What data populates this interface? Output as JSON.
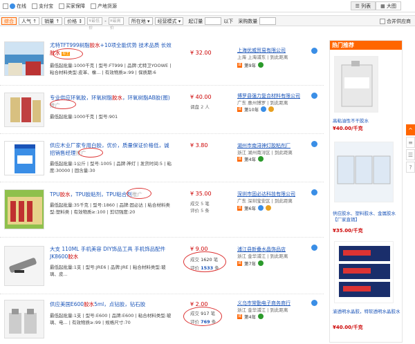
{
  "filters": {
    "online": "在线",
    "alipay": "支付宝",
    "buyer_protection": "买家保障",
    "source": "产地货源",
    "view_list": "列表",
    "view_grid": "大图"
  },
  "sortbar": {
    "comprehensive": "综合",
    "popularity": "人气",
    "sales": "销量",
    "price": "价格",
    "price_min_placeholder": "¥最低价",
    "price_max_placeholder": "¥最高价",
    "location": "所在地",
    "business_mode": "经营模式",
    "min_order": "起订量",
    "below": "以下",
    "purchase_qty": "采购数量",
    "merge_supplier": "合并供应商"
  },
  "products": [
    {
      "title_a": "尤特TFT999树脂",
      "title_hl": "胶水",
      "title_b": "+10项全能优势 技术品质 长效",
      "title_c": "胶水",
      "tag": "标王",
      "meta1": "最低起批量:1000千克 | 型号:FT999 | 品牌:尤特卫YOOWE |",
      "meta2": "粘合材料类型:皮革、橡... | 有效物质≥:99 | 保质期:6",
      "price": "¥ 32.00",
      "company": "上海优威贸易有限公司",
      "location": "上海 上海浦东 | 到此距离",
      "years": "第9年"
    },
    {
      "title_a": "专业供应环氧胶，环氧树脂",
      "title_hl": "胶水",
      "title_b": "，环氧树脂AB胶(图)",
      "title_c": "",
      "tag": "推广",
      "meta1": "最低起批量:1000千克 | 型号:901",
      "meta2": "",
      "price": "¥ 40.00",
      "sub": "调盘 2 人",
      "company": "博罗县强力复合材料有限公司",
      "location": "广东 惠州博罗 | 到此距离",
      "years": "第10年"
    },
    {
      "title_a": "供应木业厂家专用白胶，优价，质量保证价格低，诚",
      "title_hl": "",
      "title_b": "招销售经理",
      "title_c": "",
      "tag": "推广",
      "meta1": "最低起批量:1公斤 | 型号:1005 | 品牌:神灯 | 发货时间:5 | 粘",
      "meta2": "度:30000 | 固含量:30",
      "price": "¥ 3.80",
      "company": "湖州市南浔神灯胶粘剂厂",
      "location": "浙江 湖州南浔区 | 到此距离",
      "years": "第4年"
    },
    {
      "title_a": "TPU",
      "title_hl": "胶水",
      "title_b": "，TPU胶粘剂，TPU粘合剂",
      "title_c": "",
      "tag": "推广",
      "meta1": "最低起批量:35千克 | 型号:1860 | 品牌:固必达 | 粘合材料类",
      "meta2": "型:塑料类 | 有效物质≥:100 | 剪切强度:20",
      "price": "¥ 35.00",
      "sub1": "成交 5 笔",
      "sub2": "评价 5 条",
      "company": "深圳市固必达科技有限公司",
      "location": "广东 深圳宝安区 | 到此距离",
      "years": "第6年"
    },
    {
      "title_a": "大支 110ML 手机美容 DIY饰品工具 手机饰品配件",
      "title_hl": "",
      "title_b": "JK8600",
      "title_c": "胶水",
      "tag": "",
      "meta1": "最低起批量:1支 | 型号:JRE6 | 品牌:JRE | 粘合材料类型:玻",
      "meta2": "璃、皮...",
      "price": "¥ 9.00",
      "sub1": "成交",
      "sub1n": "1620",
      "sub1u": "笔",
      "sub2": "评价",
      "sub2n": "1533",
      "sub2u": "条",
      "company": "浦江县新叠水晶饰品店",
      "location": "浙江 金华浦江 | 到此距离",
      "years": "第7年"
    },
    {
      "title_a": "供应美国E600",
      "title_hl": "胶水",
      "title_b": "5ml，点钻胶，钻石胶",
      "title_c": "",
      "tag": "",
      "meta1": "最低起批量:1支 | 型号:E600 | 品牌:E600 | 粘合材料类型:玻",
      "meta2": "璃、电... | 有效物质≥:99 | 规格尺寸:70",
      "price": "¥ 2.00",
      "sub1": "成交",
      "sub1n": "917",
      "sub1u": "笔",
      "sub2": "评价",
      "sub2n": "769",
      "sub2u": "条",
      "company": "义乌市常勤电子商务商行",
      "location": "浙江 金华浦江 | 到此距离",
      "years": "第4年"
    }
  ],
  "hot": {
    "header": "热门推荐",
    "items": [
      {
        "title": "高粘油性不干胶水",
        "price": "¥40.00/千克"
      },
      {
        "title": "供应胶水、塑料胶水、金属胶水【厂家直销】",
        "price": "¥35.00/千克"
      },
      {
        "title": "渝透明水晶胶，特软透明水晶胶水",
        "price": "¥40.00/千克"
      }
    ]
  },
  "side_tools": [
    "^",
    "≡",
    "☰",
    "?"
  ]
}
